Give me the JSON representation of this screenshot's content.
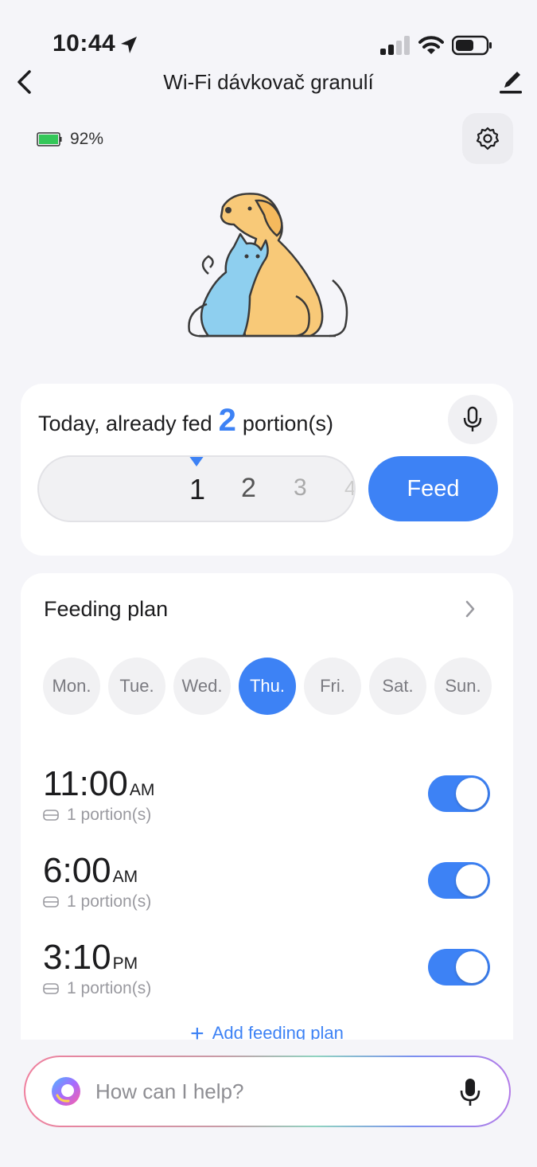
{
  "status_bar": {
    "time": "10:44"
  },
  "nav": {
    "title": "Wi-Fi dávkovač granulí"
  },
  "device": {
    "battery": "92%"
  },
  "feed": {
    "prefix": "Today, already fed",
    "count": "2",
    "suffix": "portion(s)",
    "picker_options": [
      "1",
      "2",
      "3",
      "4"
    ],
    "selected": "1",
    "button": "Feed"
  },
  "plan": {
    "title": "Feeding plan",
    "days": [
      "Mon.",
      "Tue.",
      "Wed.",
      "Thu.",
      "Fri.",
      "Sat.",
      "Sun."
    ],
    "active_day": "Thu.",
    "items": [
      {
        "time": "11:00",
        "ampm": "AM",
        "portion": "1 portion(s)",
        "enabled": true
      },
      {
        "time": "6:00",
        "ampm": "AM",
        "portion": "1 portion(s)",
        "enabled": true
      },
      {
        "time": "3:10",
        "ampm": "PM",
        "portion": "1 portion(s)",
        "enabled": true
      }
    ],
    "add_label": "Add feeding plan"
  },
  "assistant": {
    "placeholder": "How can I help?"
  },
  "colors": {
    "accent": "#3d82f5",
    "battery_green": "#34c759"
  },
  "icons": [
    "location-arrow-icon",
    "signal-icon",
    "wifi-icon",
    "battery-icon",
    "back-icon",
    "edit-icon",
    "settings-gear-icon",
    "microphone-icon",
    "chevron-right-icon",
    "bowl-icon",
    "plus-icon",
    "assistant-logo-icon"
  ]
}
